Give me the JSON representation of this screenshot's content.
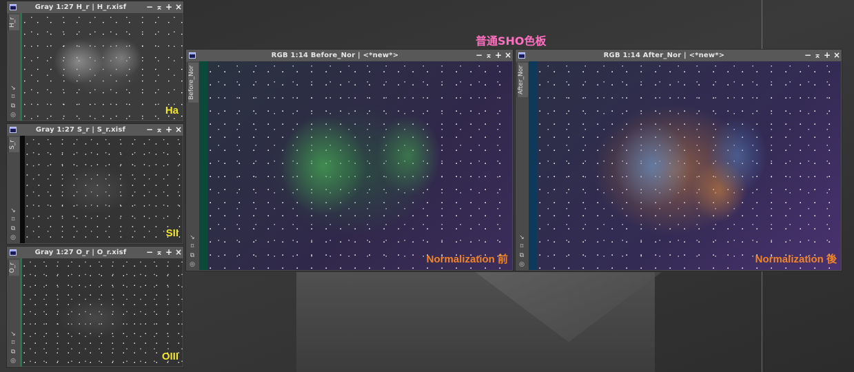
{
  "annotation": {
    "header": "普通SHO色板"
  },
  "windows": {
    "h": {
      "title": "Gray 1:27 H_r | H_r.xisf",
      "tab": "H_r",
      "label": "Ha"
    },
    "s": {
      "title": "Gray 1:27 S_r | S_r.xisf",
      "tab": "S_r",
      "label": "SII"
    },
    "o": {
      "title": "Gray 1:27 O_r | O_r.xisf",
      "tab": "O_r",
      "label": "OIII"
    },
    "before": {
      "title": "RGB 1:14 Before_Nor | <*new*>",
      "tab": "Before_Nor",
      "label": "Normalization 前"
    },
    "after": {
      "title": "RGB 1:14 After_Nor | <*new*>",
      "tab": "After_Nor",
      "label": "Normalization 後"
    }
  },
  "controls": {
    "minimize": "−",
    "shade": "⌅",
    "maximize": "+",
    "close": "×"
  },
  "tools": [
    "↘",
    "⌑",
    "⧉",
    "◎"
  ],
  "colors": {
    "yellow_label": "#f3e62a",
    "orange_label": "#f0842a",
    "header": "#ff6fbf",
    "guide": "#c9823a"
  }
}
